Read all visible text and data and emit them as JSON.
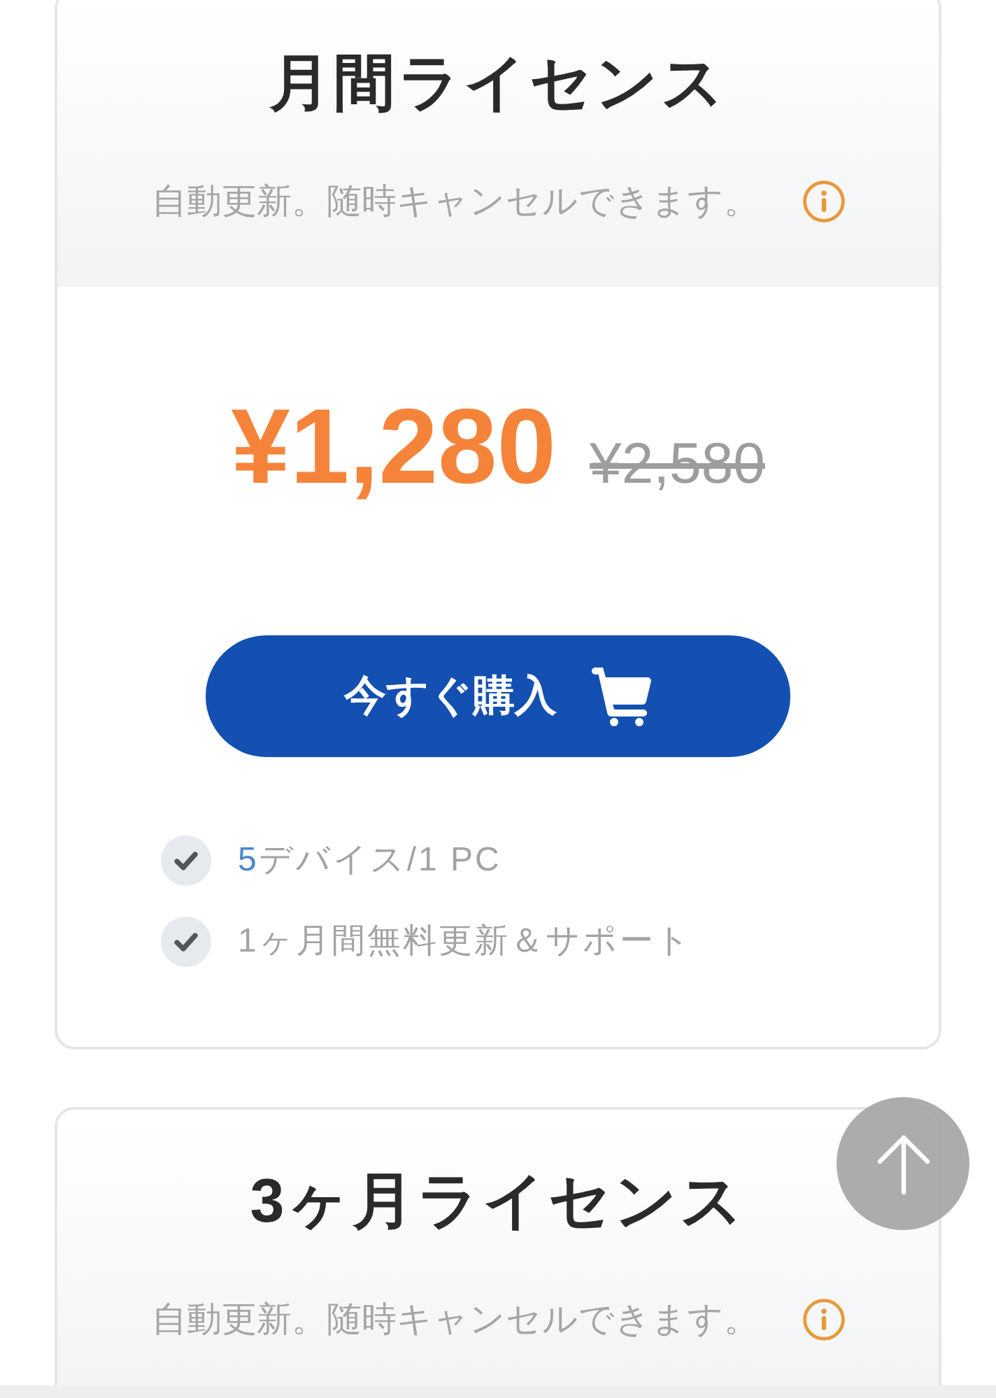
{
  "plans": [
    {
      "title": "月間ライセンス",
      "subtitle": "自動更新。随時キャンセルできます。",
      "price": "¥1,280",
      "original_price": "¥2,580",
      "buy_button": "今すぐ購入",
      "features": [
        {
          "parts": [
            {
              "text": "5",
              "highlight": true
            },
            {
              "text": "デバイス/1 PC",
              "highlight": false
            }
          ]
        },
        {
          "parts": [
            {
              "text": "1ヶ月間無料更新＆サポート",
              "highlight": false
            }
          ]
        }
      ]
    },
    {
      "title": "3ヶ月ライセンス",
      "subtitle": "自動更新。随時キャンセルできます。"
    }
  ]
}
